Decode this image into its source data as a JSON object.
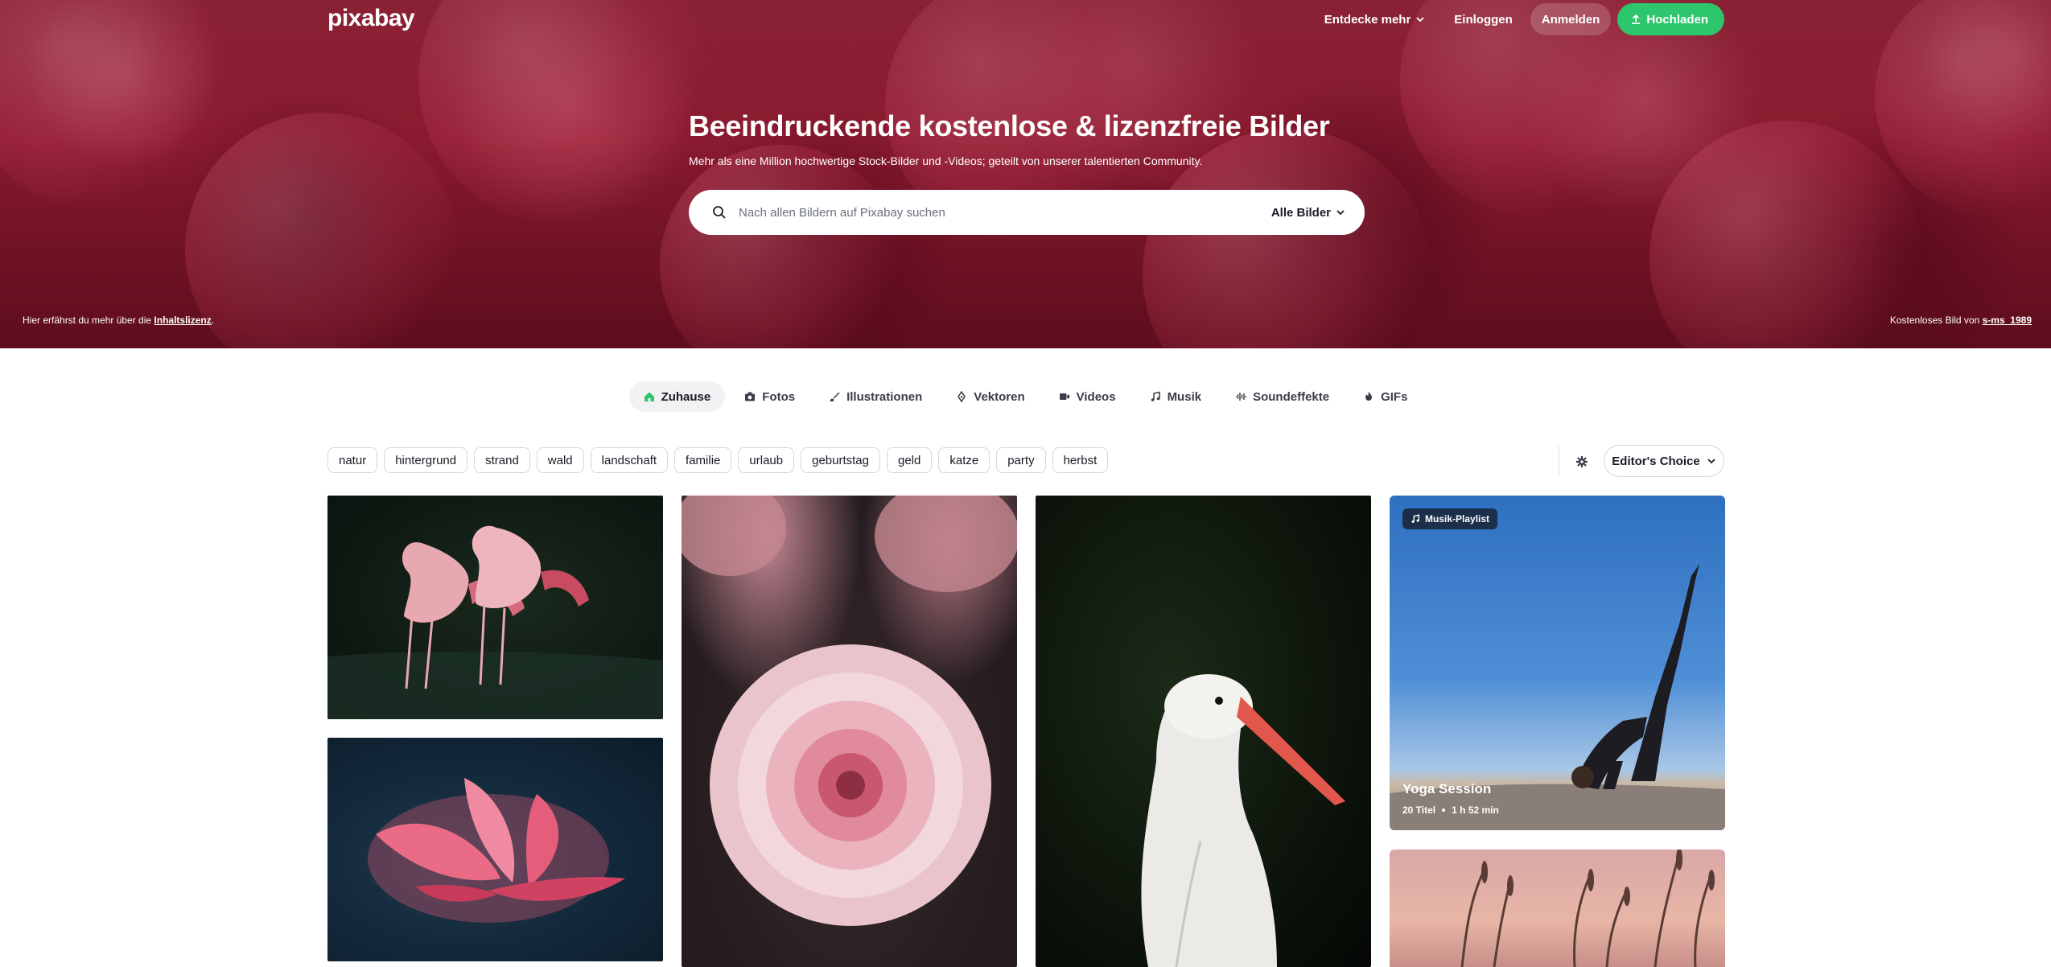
{
  "header": {
    "logo": "pixabay",
    "explore": "Entdecke mehr",
    "login": "Einloggen",
    "signup": "Anmelden",
    "upload": "Hochladen"
  },
  "hero": {
    "title": "Beeindruckende kostenlose & lizenzfreie Bilder",
    "subtitle": "Mehr als eine Million hochwertige Stock-Bilder und -Videos; geteilt von unserer talentierten Community.",
    "search_placeholder": "Nach allen Bildern auf Pixabay suchen",
    "search_filter": "Alle Bilder",
    "license_prefix": "Hier erfährst du mehr über die ",
    "license_link": "Inhaltslizenz",
    "license_suffix": ".",
    "credit_prefix": "Kostenloses Bild von ",
    "credit_user": "s-ms_1989"
  },
  "tabs": [
    {
      "label": "Zuhause",
      "icon": "home-icon",
      "active": true
    },
    {
      "label": "Fotos",
      "icon": "camera-icon"
    },
    {
      "label": "Illustrationen",
      "icon": "brush-icon"
    },
    {
      "label": "Vektoren",
      "icon": "pen-nib-icon"
    },
    {
      "label": "Videos",
      "icon": "video-icon"
    },
    {
      "label": "Musik",
      "icon": "music-note-icon"
    },
    {
      "label": "Soundeffekte",
      "icon": "waveform-icon"
    },
    {
      "label": "GIFs",
      "icon": "flame-icon"
    }
  ],
  "tags": [
    "natur",
    "hintergrund",
    "strand",
    "wald",
    "landschaft",
    "familie",
    "urlaub",
    "geburtstag",
    "geld",
    "katze",
    "party",
    "herbst"
  ],
  "sort": {
    "label": "Editor's Choice"
  },
  "playlist": {
    "badge": "Musik-Playlist",
    "title": "Yoga Session",
    "tracks": "20 Titel",
    "duration": "1 h 52 min"
  },
  "colors": {
    "accent_green": "#2ec66d",
    "text_dark": "#191b26",
    "tab_active_bg": "#f1f2f4"
  }
}
